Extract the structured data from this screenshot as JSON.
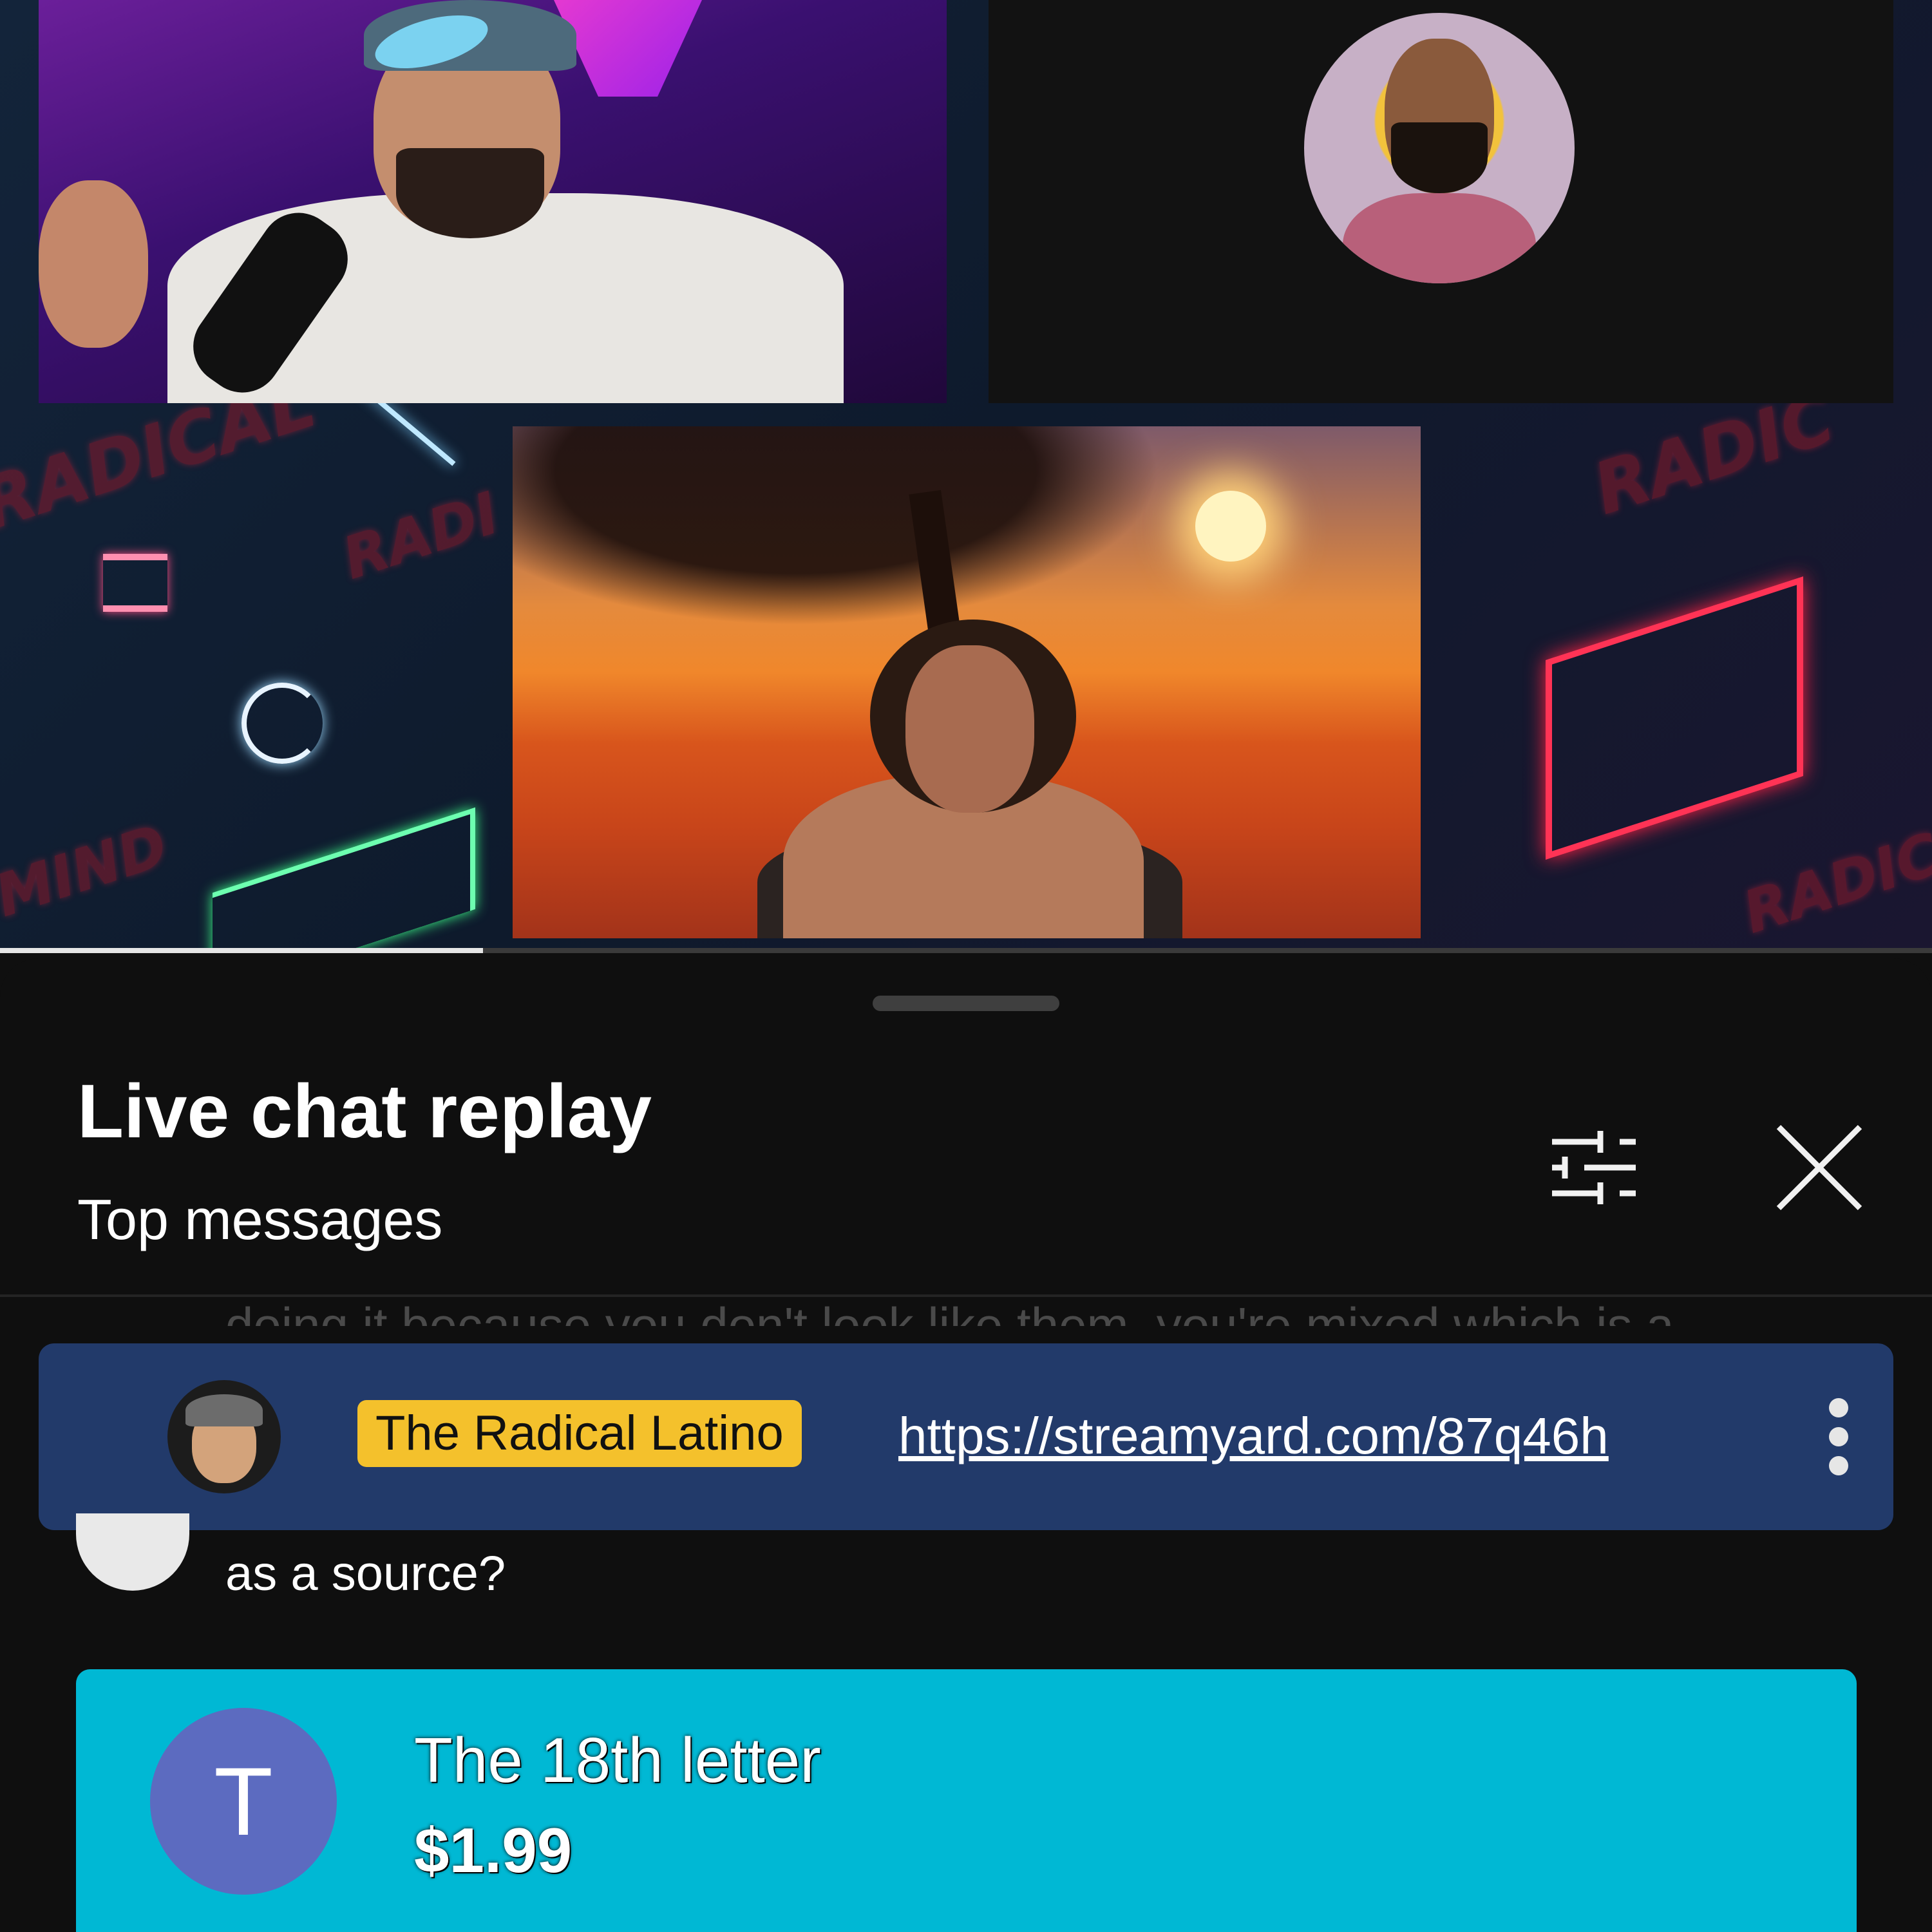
{
  "video": {
    "background_text": [
      "RADICAL",
      "RADI",
      "RADIC",
      "MIND",
      "RADICAL"
    ],
    "progress_fraction": 0.25
  },
  "chat": {
    "title": "Live chat replay",
    "subtitle": "Top messages",
    "truncated_message": "doing it because you don't look like them, you're mixed which is a",
    "pinned": {
      "author": "The Radical Latino",
      "message": "https://streamyard.com/87q46h"
    },
    "message": {
      "text": "as a source?"
    },
    "superchat": {
      "initial": "T",
      "name": "The 18th letter",
      "amount": "$1.99",
      "color": "#00b8d4"
    }
  },
  "icons": [
    "filter-icon",
    "close-icon",
    "more-vert-icon"
  ],
  "colors": {
    "background": "#0f0f0f",
    "pinned_bg": "#223a6a",
    "author_badge": "#f4c12c",
    "superchat_bg": "#00b8d4",
    "superchat_avatar": "#5c6bc0"
  }
}
